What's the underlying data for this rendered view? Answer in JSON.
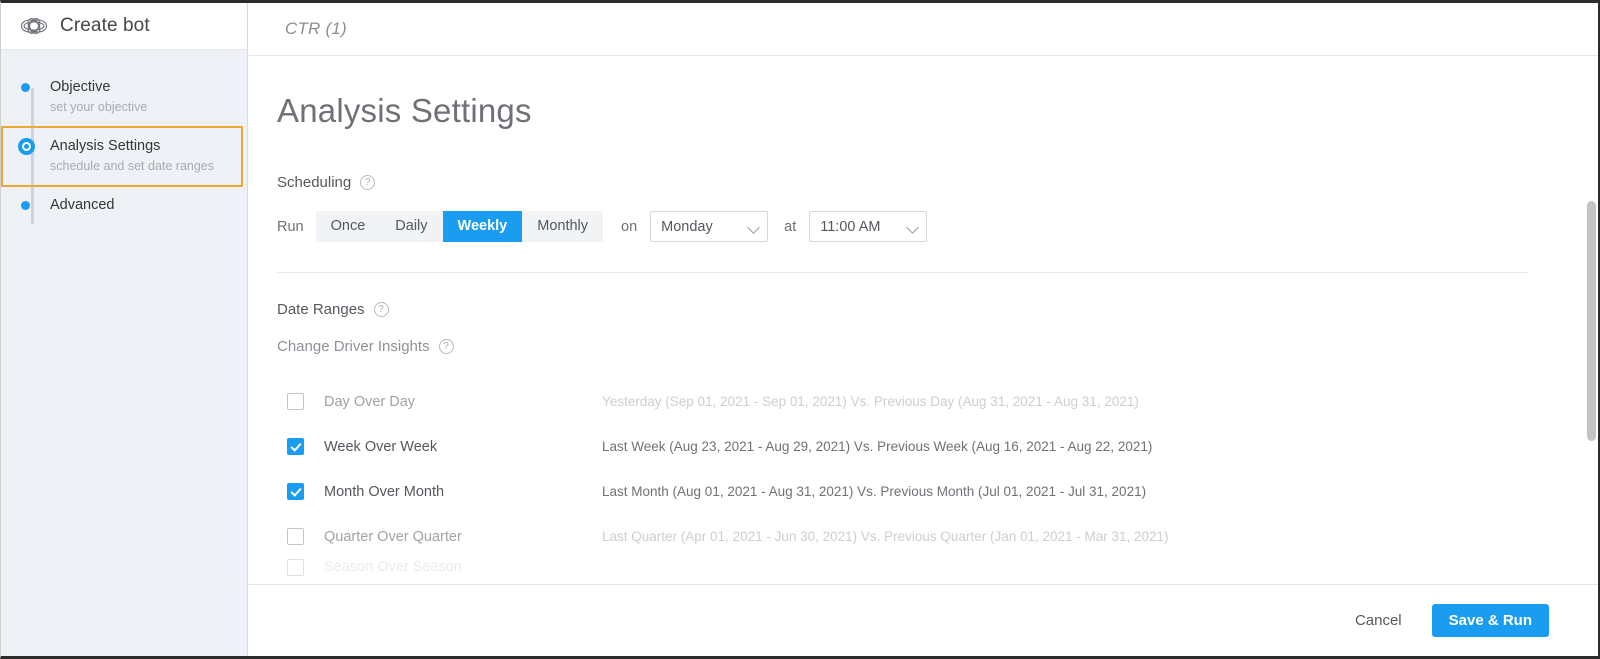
{
  "sidebar": {
    "brand": "Create bot",
    "logo_icon": "knot-logo-icon",
    "steps": [
      {
        "title": "Objective",
        "subtitle": "set your objective",
        "state": "complete"
      },
      {
        "title": "Analysis Settings",
        "subtitle": "schedule and set date ranges",
        "state": "active"
      },
      {
        "title": "Advanced",
        "subtitle": "",
        "state": "pending"
      }
    ]
  },
  "topbar": {
    "breadcrumb": "CTR (1)"
  },
  "page": {
    "title": "Analysis Settings"
  },
  "scheduling": {
    "section_label": "Scheduling",
    "help_glyph": "?",
    "run_label": "Run",
    "frequencies": [
      {
        "label": "Once",
        "selected": false
      },
      {
        "label": "Daily",
        "selected": false
      },
      {
        "label": "Weekly",
        "selected": true
      },
      {
        "label": "Monthly",
        "selected": false
      }
    ],
    "on_label": "on",
    "day_value": "Monday",
    "at_label": "at",
    "time_value": "11:00 AM"
  },
  "date_ranges": {
    "section_label": "Date Ranges",
    "sub_label": "Change Driver Insights",
    "help_glyph": "?",
    "rows": [
      {
        "label": "Day Over Day",
        "checked": false,
        "range": "Yesterday (Sep 01, 2021 - Sep 01, 2021) Vs. Previous Day (Aug 31, 2021 - Aug 31, 2021)"
      },
      {
        "label": "Week Over Week",
        "checked": true,
        "range": "Last Week (Aug 23, 2021 - Aug 29, 2021) Vs. Previous Week (Aug 16, 2021 - Aug 22, 2021)"
      },
      {
        "label": "Month Over Month",
        "checked": true,
        "range": "Last Month (Aug 01, 2021 - Aug 31, 2021) Vs. Previous Month (Jul 01, 2021 - Jul 31, 2021)"
      },
      {
        "label": "Quarter Over Quarter",
        "checked": false,
        "range": "Last Quarter (Apr 01, 2021 - Jun 30, 2021) Vs. Previous Quarter (Jan 01, 2021 - Mar 31, 2021)"
      },
      {
        "label": "Season Over Season",
        "checked": false,
        "range": "",
        "clipped": true
      }
    ]
  },
  "footer": {
    "cancel_label": "Cancel",
    "save_label": "Save & Run"
  },
  "colors": {
    "accent_blue": "#1a9df0",
    "highlight_orange": "#eda833",
    "sidebar_bg": "#eef1f5",
    "text_primary": "#54585d",
    "text_muted": "#9fa3a8"
  }
}
